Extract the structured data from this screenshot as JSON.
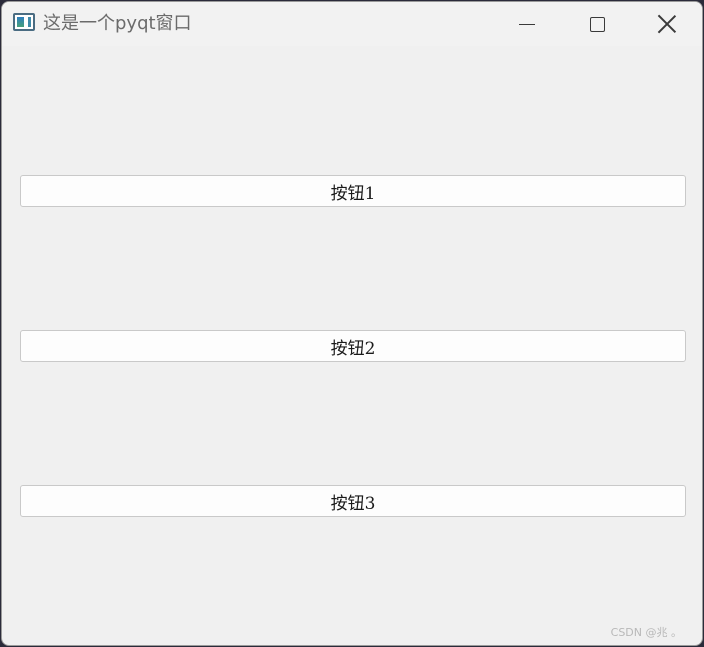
{
  "window": {
    "title": "这是一个pyqt窗口",
    "icon": "app-window-icon",
    "controls": {
      "minimize": "minimize-icon",
      "maximize": "maximize-icon",
      "close": "close-icon"
    }
  },
  "buttons": [
    {
      "label": "按钮1"
    },
    {
      "label": "按钮2"
    },
    {
      "label": "按钮3"
    }
  ],
  "watermark": "CSDN @兆 。",
  "colors": {
    "window_bg": "#f0f0f0",
    "button_bg": "#fdfdfd",
    "button_border": "#c9c9c9",
    "title_text": "#6b6b6b"
  }
}
